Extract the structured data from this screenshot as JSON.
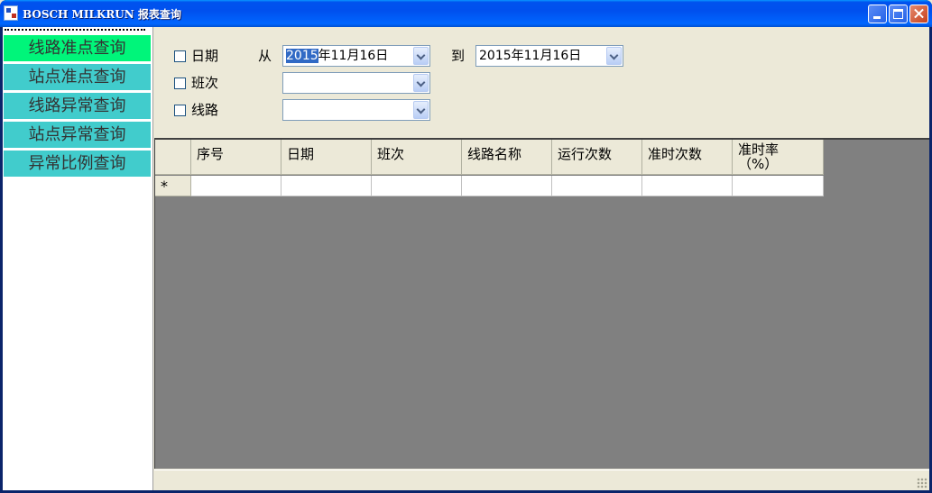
{
  "window": {
    "title": "BOSCH MILKRUN 报表查询"
  },
  "sidebar": {
    "items": [
      {
        "label": "线路准点查询",
        "active": true
      },
      {
        "label": "站点准点查询"
      },
      {
        "label": "线路异常查询"
      },
      {
        "label": "站点异常查询"
      },
      {
        "label": "异常比例查询"
      }
    ]
  },
  "filter": {
    "date_label": "日期",
    "shift_label": "班次",
    "route_label": "线路",
    "from_label": "从",
    "to_label": "到",
    "from_date_selected": "2015",
    "from_date_rest": "年11月16日",
    "to_date": "2015年11月16日",
    "shift_value": "",
    "route_value": ""
  },
  "grid": {
    "columns": [
      "序号",
      "日期",
      "班次",
      "线路名称",
      "运行次数",
      "准时次数"
    ],
    "last_column_line1": "准时率",
    "last_column_line2": "（%）",
    "new_row_marker": "*"
  },
  "colors": {
    "nav_item": "#41CCCC",
    "nav_active": "#00F57A",
    "grid_background": "#808080"
  }
}
